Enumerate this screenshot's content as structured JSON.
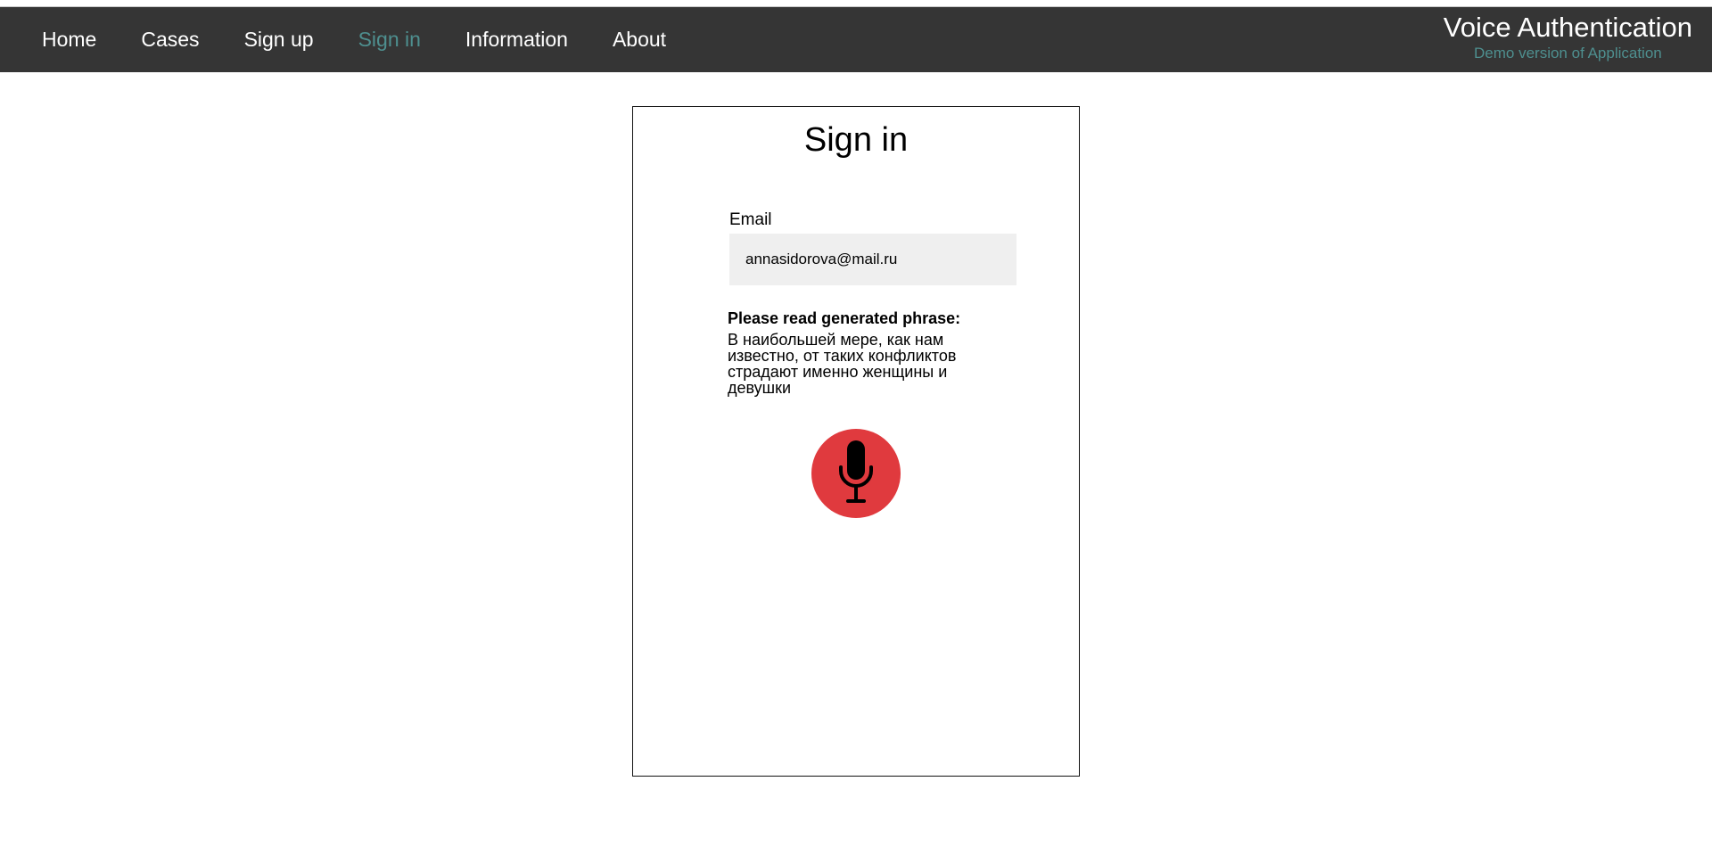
{
  "nav": {
    "items": [
      {
        "label": "Home"
      },
      {
        "label": "Cases"
      },
      {
        "label": "Sign up"
      },
      {
        "label": "Sign in"
      },
      {
        "label": "Information"
      },
      {
        "label": "About"
      }
    ],
    "active": "Sign in"
  },
  "brand": {
    "title": "Voice Authentication",
    "subtitle": "Demo version of Application"
  },
  "form": {
    "title": "Sign in",
    "email_label": "Email",
    "email_value": "annasidorova@mail.ru",
    "phrase_label": "Please read generated phrase:",
    "phrase_text": "В наибольшей мере, как нам известно, от таких конфликтов страдают именно женщины и девушки",
    "record_icon": "microphone-icon"
  },
  "colors": {
    "navbar": "#353535",
    "accent": "#4e8f8f",
    "record_button": "#e03a3e"
  }
}
